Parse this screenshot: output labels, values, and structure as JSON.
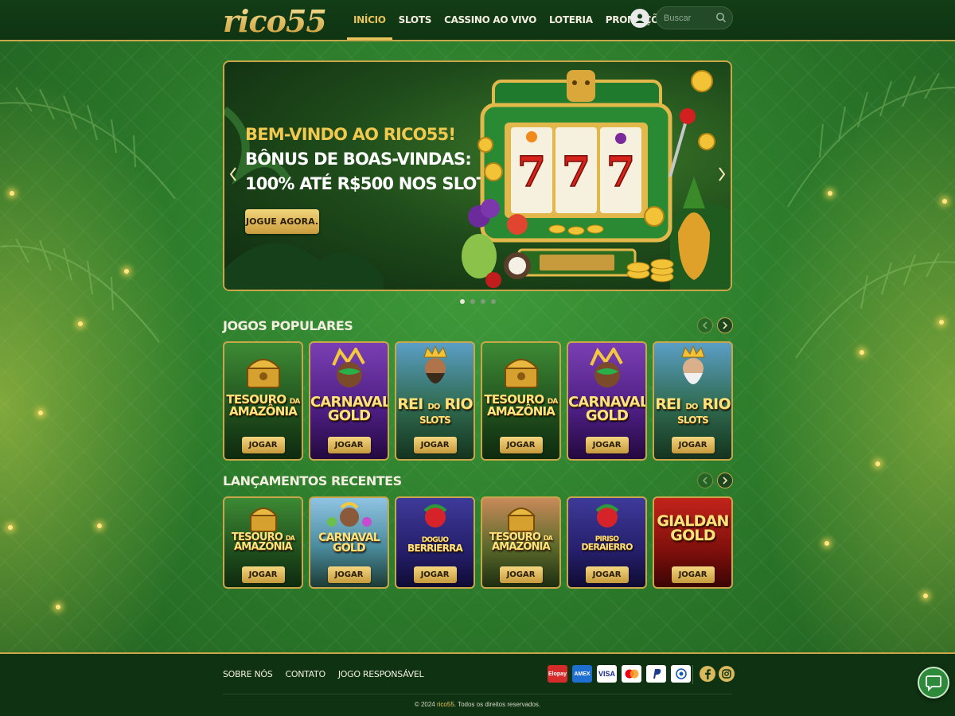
{
  "header": {
    "logo": "rico55",
    "nav": [
      "INÍCIO",
      "SLOTS",
      "CASSINO AO VIVO",
      "LOTERIA",
      "PROMOÇÕES"
    ],
    "active_nav": "INÍCIO",
    "search": {
      "placeholder": "Buscar",
      "value": ""
    }
  },
  "hero": {
    "line1": "BEM-VINDO AO RICO55!",
    "line2": "BÔNUS DE BOAS-VINDAS:",
    "line3": "100% ATÉ R$500 NOS SLOTS!",
    "cta": "JOGUE AGORA.",
    "reels": [
      "7",
      "7",
      "7"
    ],
    "slides_total": 4,
    "active_slide": 1
  },
  "popular": {
    "title": "JOGOS POPULARES",
    "games": [
      {
        "title_top": "TESOURO",
        "title_mid": "DA",
        "title_bottom": "AMAZÔNIA",
        "button": "JOGAR"
      },
      {
        "title_top": "CARNAVAL",
        "title_bottom": "GOLD",
        "button": "JOGAR"
      },
      {
        "title_top": "REI",
        "title_mid": "DO",
        "title_bottom": "RIO",
        "title_sub": "SLOTS",
        "button": "JOGAR"
      },
      {
        "title_top": "TESOURO",
        "title_mid": "DA",
        "title_bottom": "AMAZÔNIA",
        "button": "JOGAR"
      },
      {
        "title_top": "CARNAVAL",
        "title_bottom": "GOLD",
        "button": "JOGAR"
      },
      {
        "title_top": "REI",
        "title_mid": "DO",
        "title_bottom": "RIO",
        "title_sub": "SLOTS",
        "button": "JOGAR"
      }
    ]
  },
  "recent": {
    "title": "LANÇAMENTOS RECENTES",
    "games": [
      {
        "title_top": "TESOURO",
        "title_mid": "DA",
        "title_bottom": "AMAZÔNIA",
        "button": "JOGAR"
      },
      {
        "title_top": "CARNAVAL",
        "title_bottom": "GOLD",
        "button": "JOGAR"
      },
      {
        "title_top": "DOGUO",
        "title_bottom": "BERRIERRA",
        "button": "JOGAR"
      },
      {
        "title_top": "TESOURO",
        "title_mid": "DA",
        "title_bottom": "AMAZÔNIA",
        "button": "JOGAR"
      },
      {
        "title_top": "PIRISO",
        "title_bottom": "DERAIERRO",
        "button": "JOGAR"
      },
      {
        "title_top": "GIALDAN",
        "title_bottom": "GOLD",
        "button": "JOGAR"
      }
    ]
  },
  "footer": {
    "links": [
      "SOBRE NÓS",
      "CONTATO",
      "JOGO RESPONSÁVEL"
    ],
    "payments": [
      "Elopay",
      "AMEX",
      "VISA",
      "Mastercard",
      "PayPal",
      "Diners"
    ],
    "copyright_prefix": "© 2024 ",
    "copyright_brand": "rico55",
    "copyright_suffix": ". Todos os direitos reservados."
  },
  "colors": {
    "accent_gold": "#e8c45a",
    "header_bg": "#0f3412",
    "page_green": "#2d7d2c"
  },
  "icons": [
    "user-icon",
    "search-icon",
    "chevron-left-icon",
    "chevron-right-icon",
    "facebook-icon",
    "instagram-icon",
    "chat-icon"
  ]
}
